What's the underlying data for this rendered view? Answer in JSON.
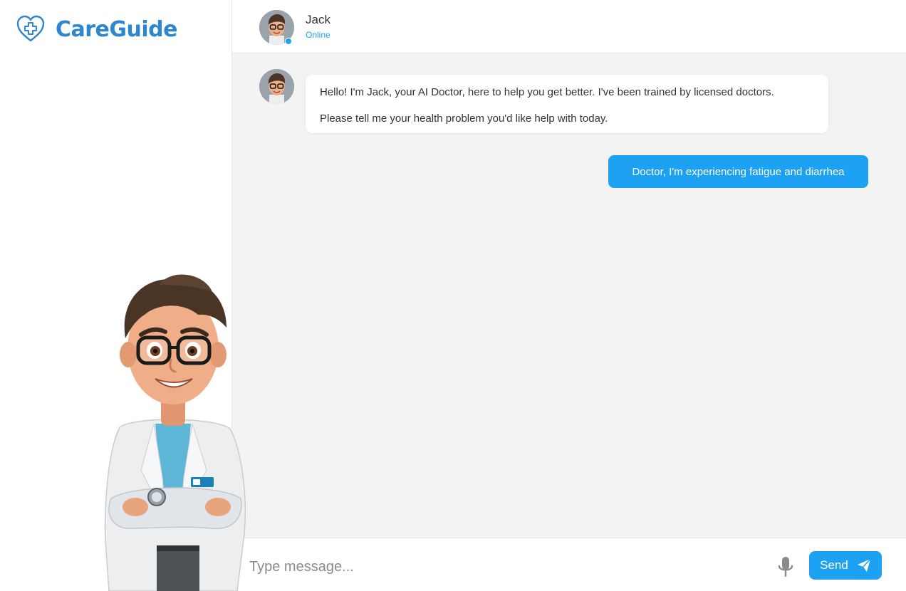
{
  "app": {
    "brand": "CareGuide"
  },
  "header": {
    "contact_name": "Jack",
    "contact_status": "Online"
  },
  "messages": [
    {
      "sender": "bot",
      "lines": [
        "Hello! I'm Jack, your AI Doctor, here to help you get better. I've been trained by licensed doctors.",
        "Please tell me your health problem you'd like help with today."
      ]
    },
    {
      "sender": "user",
      "text": "Doctor, I'm experiencing fatigue and diarrhea"
    }
  ],
  "composer": {
    "placeholder": "Type message...",
    "send_label": "Send"
  },
  "icons": {
    "logo": "heart-plus-icon",
    "mic": "microphone-icon",
    "send": "paper-plane-icon",
    "avatar": "doctor-avatar"
  },
  "colors": {
    "accent": "#1da1f2",
    "brand": "#2e86cf",
    "chat_bg": "#f3f3f3"
  }
}
